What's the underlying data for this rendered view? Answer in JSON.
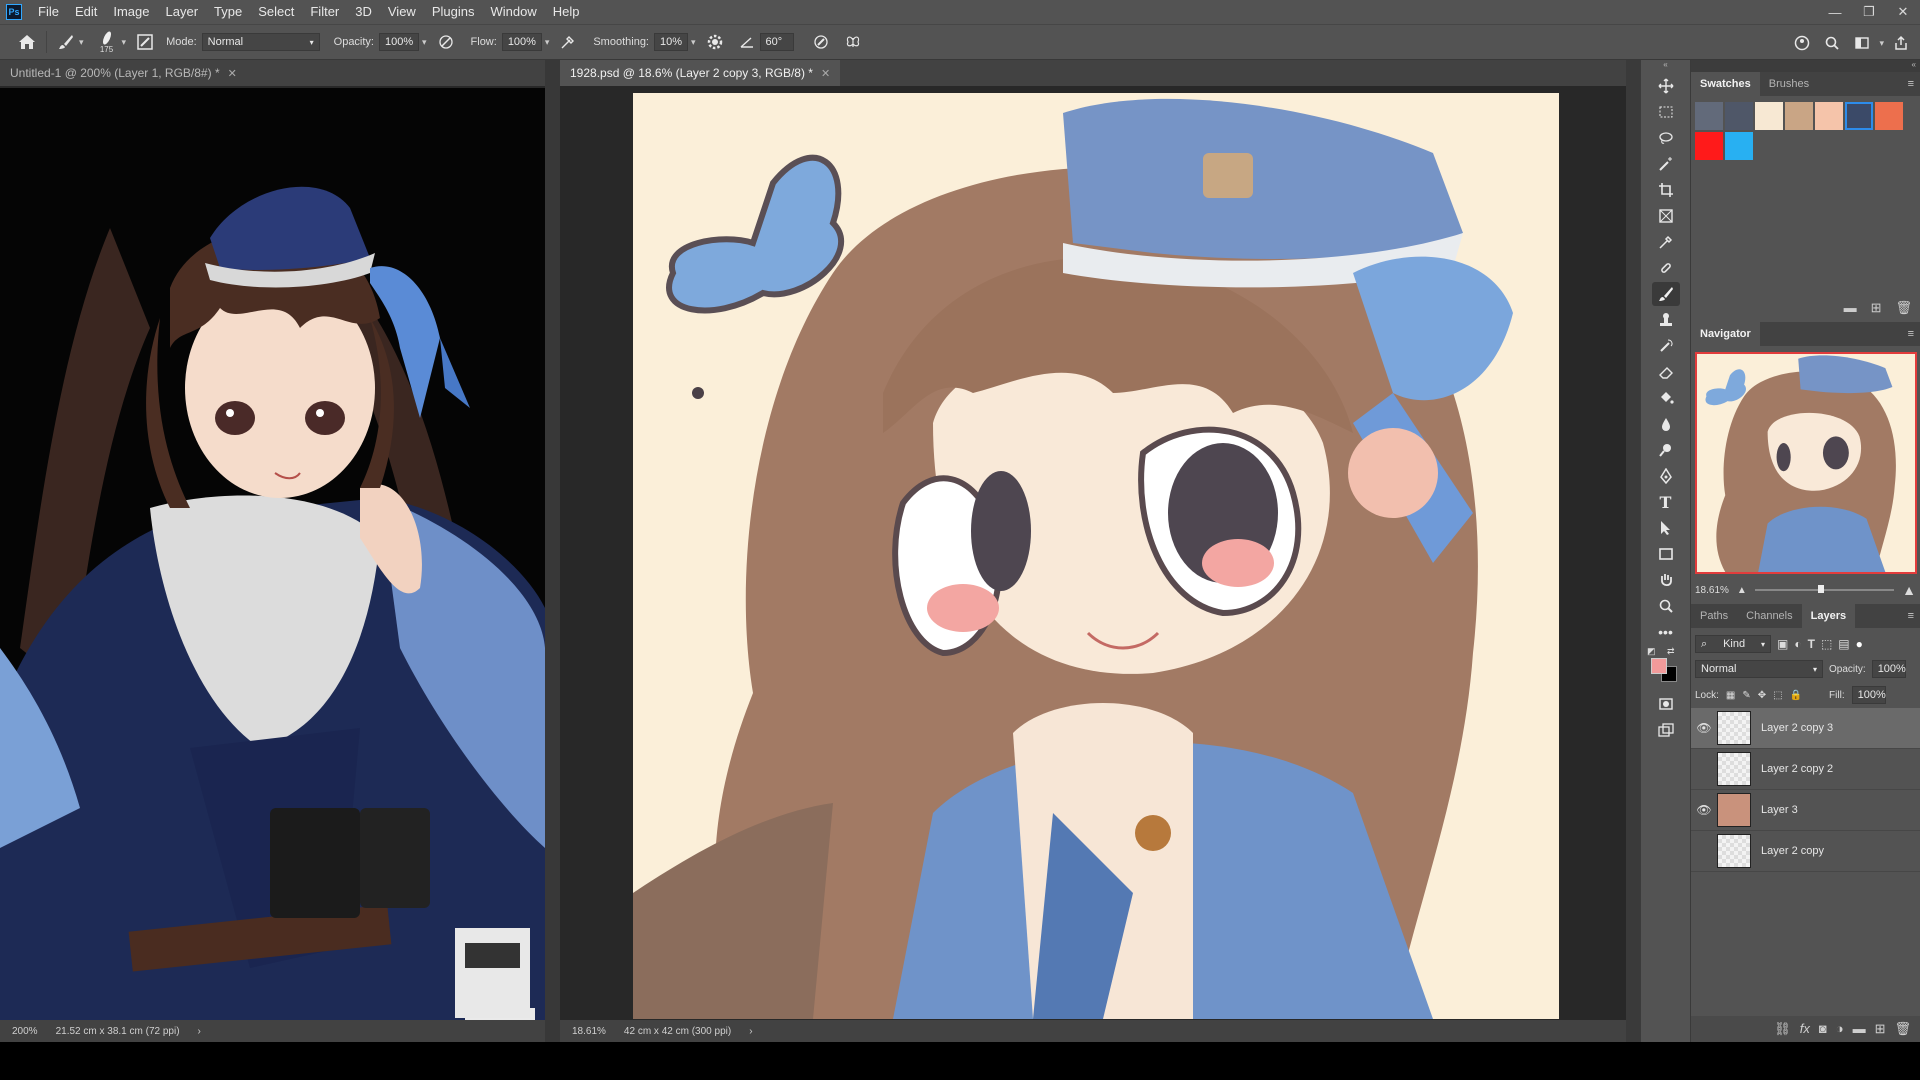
{
  "app": {
    "logo": "Ps"
  },
  "menu": [
    "File",
    "Edit",
    "Image",
    "Layer",
    "Type",
    "Select",
    "Filter",
    "3D",
    "View",
    "Plugins",
    "Window",
    "Help"
  ],
  "window_controls": {
    "minimize": "—",
    "restore": "❐",
    "close": "✕"
  },
  "options": {
    "brush_size": "175",
    "mode_label": "Mode:",
    "mode_value": "Normal",
    "opacity_label": "Opacity:",
    "opacity_value": "100%",
    "flow_label": "Flow:",
    "flow_value": "100%",
    "smoothing_label": "Smoothing:",
    "smoothing_value": "10%",
    "angle_value": "60°"
  },
  "tabs": [
    {
      "label": "Untitled-1 @ 200% (Layer 1, RGB/8#) *",
      "active": false
    },
    {
      "label": "1928.psd @ 18.6% (Layer 2 copy 3, RGB/8) *",
      "active": true
    }
  ],
  "status": {
    "doc1_zoom": "200%",
    "doc1_size": "21.52 cm x 38.1 cm (72 ppi)",
    "doc2_zoom": "18.61%",
    "doc2_size": "42 cm x 42 cm (300 ppi)"
  },
  "swatches_panel": {
    "tabs": [
      "Swatches",
      "Brushes"
    ],
    "colors": [
      "#626a7a",
      "#4f5768",
      "#f7e8d3",
      "#c9a585",
      "#f5c4aa",
      "#3b4a68",
      "#ed6f4d",
      "#ff1a1a",
      "#28b0f2"
    ]
  },
  "navigator": {
    "title": "Navigator",
    "zoom": "18.61%"
  },
  "layers_panel": {
    "tabs": [
      "Paths",
      "Channels",
      "Layers"
    ],
    "kind": "Kind",
    "blend": "Normal",
    "opacity_label": "Opacity:",
    "opacity_value": "100%",
    "lock_label": "Lock:",
    "fill_label": "Fill:",
    "fill_value": "100%",
    "layers": [
      {
        "name": "Layer 2 copy 3",
        "visible": true,
        "selected": true
      },
      {
        "name": "Layer 2 copy 2",
        "visible": false,
        "selected": false
      },
      {
        "name": "Layer 3",
        "visible": true,
        "selected": false
      },
      {
        "name": "Layer 2 copy",
        "visible": false,
        "selected": false
      }
    ]
  },
  "foreground_color": "#f19a9a",
  "background_color": "#000000"
}
